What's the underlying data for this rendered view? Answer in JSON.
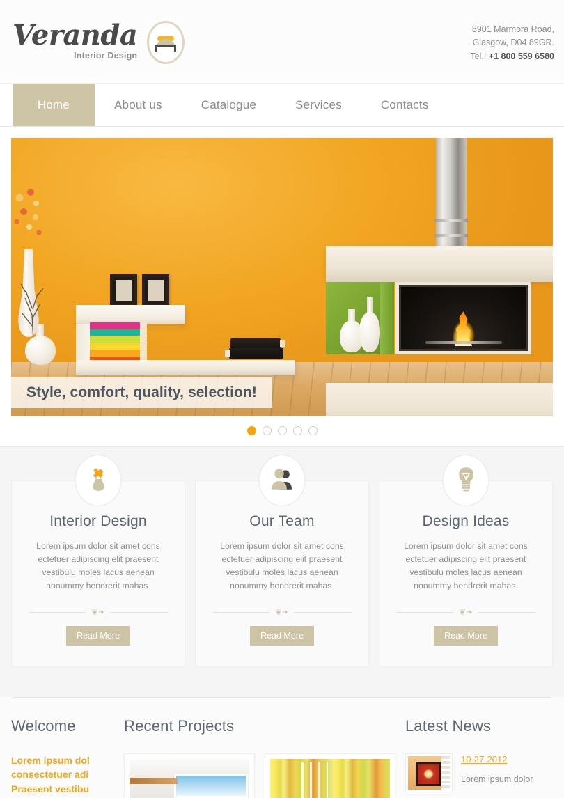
{
  "header": {
    "logo_name": "Veranda",
    "logo_sub": "Interior Design",
    "logo_icon": "bed-icon",
    "address_line1": "8901 Marmora Road,",
    "address_line2": "Glasgow, D04 89GR.",
    "phone_label": "Tel.: ",
    "phone_number": "+1 800 559 6580"
  },
  "nav": {
    "items": [
      {
        "label": "Home",
        "active": true
      },
      {
        "label": "About us",
        "active": false
      },
      {
        "label": "Catalogue",
        "active": false
      },
      {
        "label": "Services",
        "active": false
      },
      {
        "label": "Contacts",
        "active": false
      }
    ]
  },
  "hero": {
    "caption": "Style, comfort, quality, selection!",
    "slides_total": 5,
    "active_slide": 1,
    "dots": [
      "1",
      "2",
      "3",
      "4",
      "5"
    ]
  },
  "features": [
    {
      "icon": "flower-vase-icon",
      "title": "Interior Design",
      "text": "Lorem ipsum dolor sit amet cons ectetuer adipiscing elit praesent vestibulu moles lacus aenean nonummy hendrerit mahas.",
      "button": "Read More"
    },
    {
      "icon": "people-icon",
      "title": "Our Team",
      "text": "Lorem ipsum dolor sit amet cons ectetuer adipiscing elit praesent vestibulu moles lacus aenean nonummy hendrerit mahas.",
      "button": "Read More"
    },
    {
      "icon": "lightbulb-icon",
      "title": "Design Ideas",
      "text": "Lorem ipsum dolor sit amet cons ectetuer adipiscing elit praesent vestibulu moles lacus aenean nonummy hendrerit mahas.",
      "button": "Read More"
    }
  ],
  "bottom": {
    "welcome": {
      "title": "Welcome",
      "lead": "Lorem ipsum dol consectetuer adi Praesent vestibu"
    },
    "projects": {
      "title": "Recent Projects",
      "thumbs": [
        "project-room-thumb",
        "project-curtain-thumb"
      ]
    },
    "news": {
      "title": "Latest News",
      "date": "10-27-2012",
      "text": "Lorem ipsum dolor"
    }
  },
  "colors": {
    "accent_tan": "#cdc3a5",
    "accent_orange": "#efa81c",
    "heading_gray": "#5c6670",
    "body_gray": "#8e8e8e",
    "hero_wall": "#f2a623",
    "dot_active": "#f5a60e"
  }
}
